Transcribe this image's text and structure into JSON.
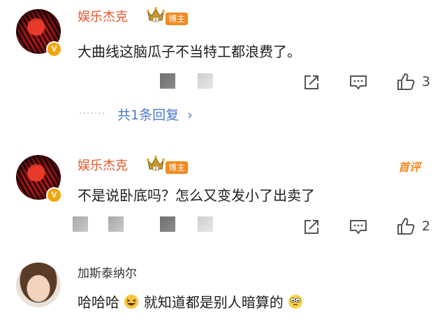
{
  "accent": "#e8552b",
  "link_color": "#4a79c7",
  "badge_color": "#f28a1e",
  "comments": [
    {
      "user": "娱乐杰克",
      "badge": "博主",
      "verified": "V",
      "text": "大曲线这脑瓜子不当特工都浪费了。",
      "likes": "3",
      "replies_label": "共1条回复",
      "replies_chevron": "›"
    },
    {
      "user": "娱乐杰克",
      "badge": "博主",
      "verified": "V",
      "text": "不是说卧底吗？怎么又变发小了出卖了",
      "likes": "2",
      "top_label": "首评"
    },
    {
      "user": "加斯泰纳尔",
      "text_a": "哈哈哈",
      "text_b": "就知道都是别人暗算的",
      "emoji_a": "grinning-squint-emoji",
      "emoji_b": "nervous-eyes-emoji"
    }
  ]
}
